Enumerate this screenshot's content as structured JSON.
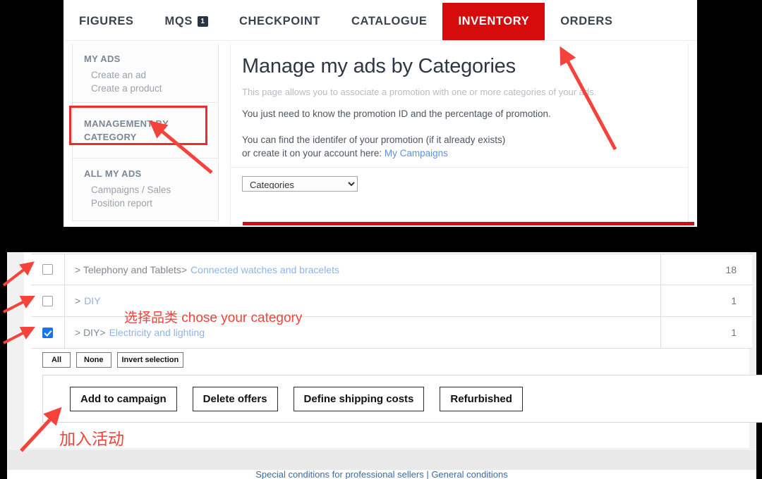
{
  "nav": {
    "items": [
      {
        "label": "FIGURES",
        "active": false,
        "badge": null
      },
      {
        "label": "MQS",
        "active": false,
        "badge": "1"
      },
      {
        "label": "CHECKPOINT",
        "active": false,
        "badge": null
      },
      {
        "label": "CATALOGUE",
        "active": false,
        "badge": null
      },
      {
        "label": "INVENTORY",
        "active": true,
        "badge": null
      },
      {
        "label": "ORDERS",
        "active": false,
        "badge": null
      }
    ],
    "active_color": "#d60b0b"
  },
  "sidebar": {
    "groups": [
      {
        "heading": "MY ADS",
        "links": [
          "Create an ad",
          "Create a product"
        ]
      },
      {
        "heading": "MANAGEMENT BY CATEGORY",
        "links": []
      },
      {
        "heading": "ALL MY ADS",
        "links": [
          "Campaigns / Sales",
          "Position report"
        ]
      }
    ],
    "highlight_color": "#ef2a2a"
  },
  "main": {
    "title": "Manage my ads by Categories",
    "intro": "This page allows you to associate a promotion with one or more categories of your ads.",
    "line2": "You just need to know the promotion ID and the percentage of promotion.",
    "line3a": "You can find the identifer of your promotion (if it already exists)",
    "line3b": "or create it on your account here:",
    "campaigns_link": "My Campaigns",
    "category_select": {
      "value": "Categories",
      "options": [
        "Categories"
      ]
    }
  },
  "table": {
    "rows": [
      {
        "checked": false,
        "crumb": "> Telephony and Tablets>",
        "leaf": "Connected watches and bracelets",
        "count": "18"
      },
      {
        "checked": false,
        "crumb": ">",
        "leaf": "DIY",
        "count": "1"
      },
      {
        "checked": true,
        "crumb": "> DIY>",
        "leaf": "Electricity and lighting",
        "count": "1"
      }
    ]
  },
  "selection_buttons": [
    {
      "label": "All"
    },
    {
      "label": "None"
    },
    {
      "label": "Invert selection"
    }
  ],
  "action_buttons": [
    {
      "label": "Add to campaign"
    },
    {
      "label": "Delete offers"
    },
    {
      "label": "Define shipping costs"
    },
    {
      "label": "Refurbished"
    }
  ],
  "footer": {
    "links_text": "Special conditions for professional sellers | General conditions"
  },
  "annotations": {
    "category_note": "选择品类 chose your category",
    "campaign_note": "加入活动",
    "color": "#f5423b"
  }
}
